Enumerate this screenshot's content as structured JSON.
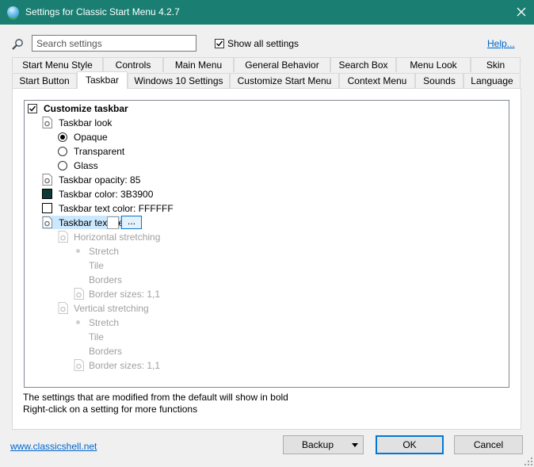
{
  "window": {
    "title": "Settings for Classic Start Menu 4.2.7",
    "title_bar_color": "#1a7f72"
  },
  "search": {
    "placeholder": "Search settings",
    "value": ""
  },
  "show_all": {
    "label": "Show all settings",
    "checked": true
  },
  "help_link": "Help...",
  "tabs_row1": [
    "Start Menu Style",
    "Controls",
    "Main Menu",
    "General Behavior",
    "Search Box",
    "Menu Look",
    "Skin"
  ],
  "tabs_row2": [
    "Start Button",
    "Taskbar",
    "Windows 10 Settings",
    "Customize Start Menu",
    "Context Menu",
    "Sounds",
    "Language"
  ],
  "active_tab": "Taskbar",
  "tree": {
    "customize_taskbar": "Customize taskbar",
    "taskbar_look": "Taskbar look",
    "look_options": [
      "Opaque",
      "Transparent",
      "Glass"
    ],
    "look_selected": "Opaque",
    "opacity": "Taskbar opacity: 85",
    "color": "Taskbar color: 3B3900",
    "color_swatch": "#0d3b39",
    "text_color": "Taskbar text color: FFFFFF",
    "text_color_swatch": "#ffffff",
    "texture": "Taskbar texture",
    "browse": "...",
    "horizontal": "Horizontal stretching",
    "h_options": [
      "Stretch",
      "Tile",
      "Borders"
    ],
    "h_border_sizes": "Border sizes: 1,1",
    "vertical": "Vertical stretching",
    "v_options": [
      "Stretch",
      "Tile",
      "Borders"
    ],
    "v_border_sizes": "Border sizes: 1,1"
  },
  "info": {
    "line1": "The settings that are modified from the default will show in bold",
    "line2": "Right-click on a setting for more functions"
  },
  "footer": {
    "website": "www.classicshell.net",
    "backup": "Backup",
    "ok": "OK",
    "cancel": "Cancel"
  }
}
